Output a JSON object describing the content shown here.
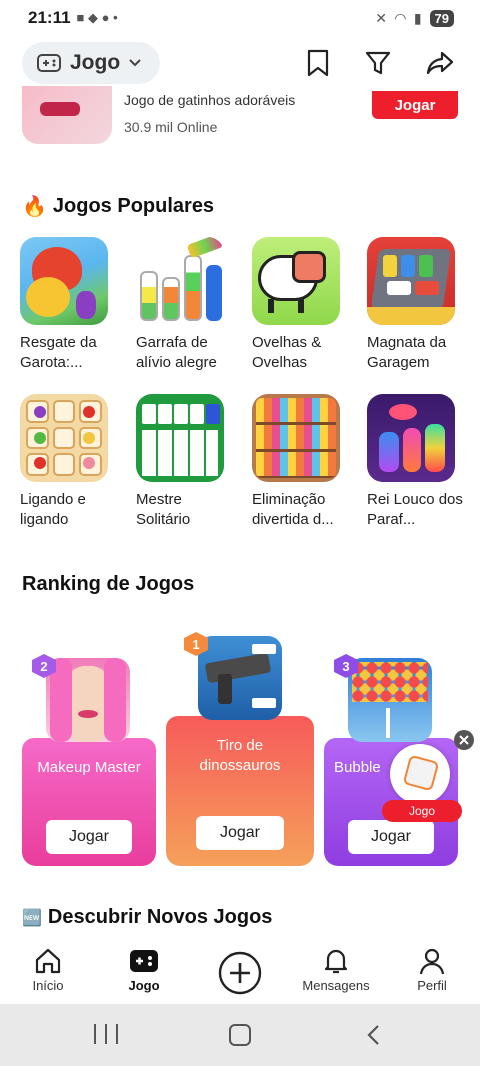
{
  "status": {
    "time": "21:11",
    "battery": "79"
  },
  "header": {
    "category_label": "Jogo"
  },
  "promo": {
    "title": "Jogo de gatinhos adoráveis",
    "online": "30.9 mil Online",
    "button": "Jogar"
  },
  "popular": {
    "title": "Jogos Populares",
    "emoji": "🔥",
    "items": [
      {
        "label": "Resgate da Garota:...",
        "icon": "dragon-icon"
      },
      {
        "label": "Garrafa de alívio alegre",
        "icon": "bottles-icon"
      },
      {
        "label": "Ovelhas & Ovelhas",
        "icon": "sheep-icon"
      },
      {
        "label": "Magnata da Garagem",
        "icon": "cars-icon"
      },
      {
        "label": "Ligando e ligando",
        "icon": "fruits-icon"
      },
      {
        "label": "Mestre Solitário",
        "icon": "cards-icon"
      },
      {
        "label": "Eliminação divertida d...",
        "icon": "shelf-icon"
      },
      {
        "label": "Rei Louco dos Paraf...",
        "icon": "screws-icon"
      }
    ]
  },
  "ranking": {
    "title": "Ranking de Jogos",
    "items": [
      {
        "rank": "2",
        "name": "Makeup Master",
        "button": "Jogar"
      },
      {
        "rank": "1",
        "name": "Tiro de dinossauros",
        "button": "Jogar"
      },
      {
        "rank": "3",
        "name": "Bubble",
        "button": "Jogar"
      }
    ],
    "float_badge": "Jogo"
  },
  "discover": {
    "emoji": "🆕",
    "title": "Descubrir Novos Jogos"
  },
  "nav": {
    "home": "Início",
    "games": "Jogo",
    "messages": "Mensagens",
    "profile": "Perfil"
  }
}
